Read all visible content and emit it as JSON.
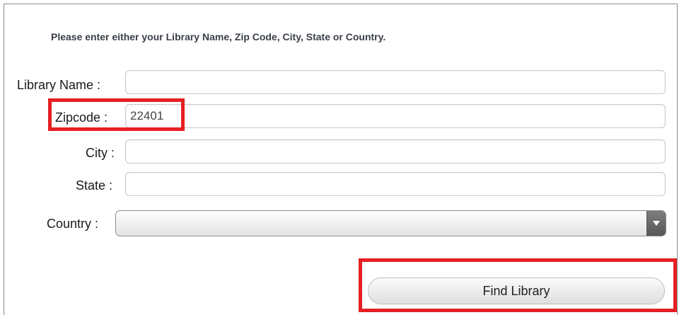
{
  "form": {
    "instructions": "Please enter either your Library Name, Zip Code, City, State or Country.",
    "fields": {
      "library_name": {
        "label": "Library Name :",
        "value": ""
      },
      "zipcode": {
        "label": "Zipcode :",
        "value": "22401"
      },
      "city": {
        "label": "City :",
        "value": ""
      },
      "state": {
        "label": "State :",
        "value": ""
      },
      "country": {
        "label": "Country :",
        "selected": ""
      }
    },
    "submit_label": "Find Library"
  },
  "icons": {
    "country_dropdown": "chevron-down-icon"
  },
  "colors": {
    "highlight": "#e51f23",
    "instructions_text": "#3a3f48"
  }
}
